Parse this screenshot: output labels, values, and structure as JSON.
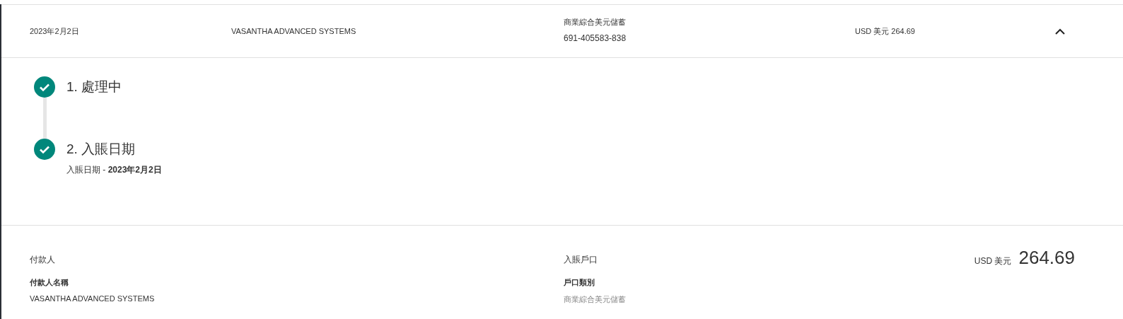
{
  "transaction": {
    "date": "2023年2月2日",
    "payer": "VASANTHA ADVANCED SYSTEMS",
    "account_type": "商業綜合美元儲蓄",
    "account_number": "691-405583-838",
    "amount": "USD 美元 264.69",
    "expanded": true
  },
  "steps": [
    {
      "title": "1. 處理中",
      "done": true
    },
    {
      "title": "2. 入賬日期",
      "done": true,
      "detail": "入賬日期 - **2023年2月2日**"
    }
  ],
  "details": {
    "payer_heading": "付款人",
    "payer_name_label": "付款人名稱",
    "payer_name": "VASANTHA ADVANCED SYSTEMS",
    "account_heading": "入賬戶口",
    "account_type_label": "戶口類別",
    "account_type": "商業綜合美元儲蓄",
    "currency": "USD 美元",
    "amount": "264.69"
  }
}
